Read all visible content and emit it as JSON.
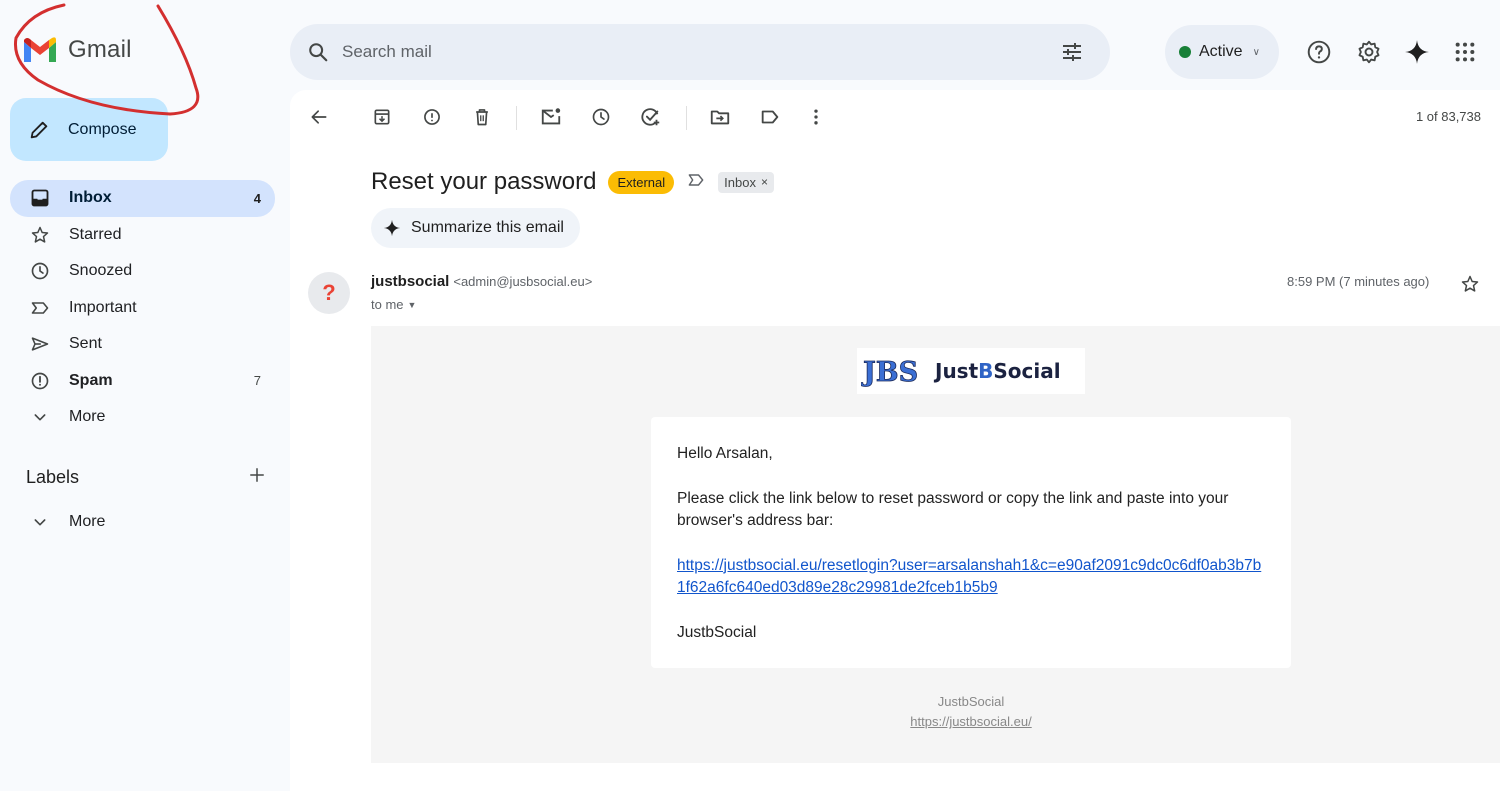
{
  "app": {
    "name": "Gmail"
  },
  "search": {
    "placeholder": "Search mail"
  },
  "status": {
    "label": "Active"
  },
  "sidebar": {
    "compose_label": "Compose",
    "items": [
      {
        "label": "Inbox",
        "count": "4",
        "icon": "inbox-icon"
      },
      {
        "label": "Starred",
        "count": "",
        "icon": "star-icon"
      },
      {
        "label": "Snoozed",
        "count": "",
        "icon": "clock-icon"
      },
      {
        "label": "Important",
        "count": "",
        "icon": "important-icon"
      },
      {
        "label": "Sent",
        "count": "",
        "icon": "send-icon"
      },
      {
        "label": "Spam",
        "count": "7",
        "icon": "spam-icon"
      },
      {
        "label": "More",
        "count": "",
        "icon": "chevron-down-icon"
      }
    ],
    "labels_title": "Labels",
    "labels_more": "More"
  },
  "toolbar": {
    "pager": "1 of 83,738"
  },
  "email": {
    "subject": "Reset your password",
    "external_badge": "External",
    "inbox_badge": "Inbox",
    "summarize_label": "Summarize this email",
    "avatar_text": "?",
    "sender_name": "justbsocial",
    "sender_email": "<admin@jusbsocial.eu>",
    "to_line": "to me",
    "time": "8:59 PM (7 minutes ago)",
    "brand_logo_text": "JBS",
    "brand_name_1": "Just",
    "brand_name_2": "B",
    "brand_name_3": "Social",
    "greeting": "Hello Arsalan,",
    "instructions": "Please click the link below to reset password or copy the link and paste into your browser's address bar:",
    "reset_link": "https://justbsocial.eu/resetlogin?user=arsalanshah1&c=e90af2091c9dc0c6df0ab3b7b1f62a6fc640ed03d89e28c29981de2fceb1b5b9",
    "signature": "JustbSocial",
    "footer_name": "JustbSocial",
    "footer_link": "https://justbsocial.eu/"
  },
  "colors": {
    "compose_bg": "#c2e7ff",
    "active_nav_bg": "#d3e3fd",
    "external_badge": "#fbbc04",
    "status_dot": "#188038",
    "link": "#1155cc",
    "annotation": "#d32f2f"
  }
}
